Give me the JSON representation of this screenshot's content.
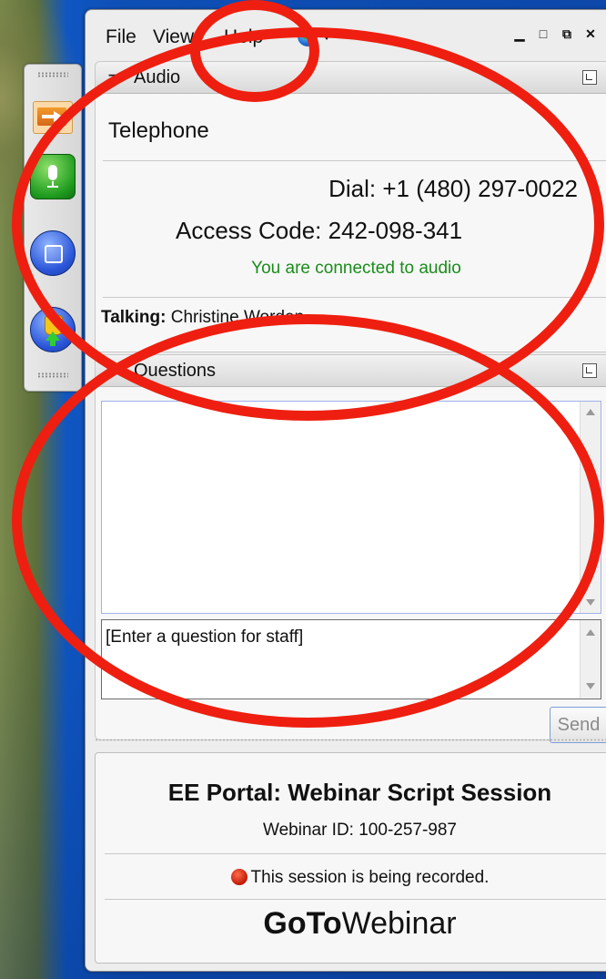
{
  "menu": {
    "file": "File",
    "view": "View",
    "help": "Help"
  },
  "window_controls": {
    "minimize": "▁",
    "maximize": "□",
    "restore": "⧉",
    "close": "✕"
  },
  "audio": {
    "header": "Audio",
    "mode": "Telephone",
    "dial": "Dial: +1 (480) 297-0022",
    "access_code": "Access Code: 242-098-341",
    "status": "You are connected to audio",
    "talking_label": "Talking:",
    "talking_name": "Christine Worden"
  },
  "questions": {
    "header": "Questions",
    "input_placeholder": "[Enter a question for staff]",
    "send_label": "Send"
  },
  "session": {
    "title": "EE Portal: Webinar Script Session",
    "webinar_id": "Webinar ID: 100-257-987",
    "recording": "This session is being recorded.",
    "brand_bold": "GoTo",
    "brand_thin": "Webinar"
  },
  "colors": {
    "connected_status": "#1b8c1b",
    "annotation": "#ee1f10",
    "record_dot": "#c01808"
  }
}
